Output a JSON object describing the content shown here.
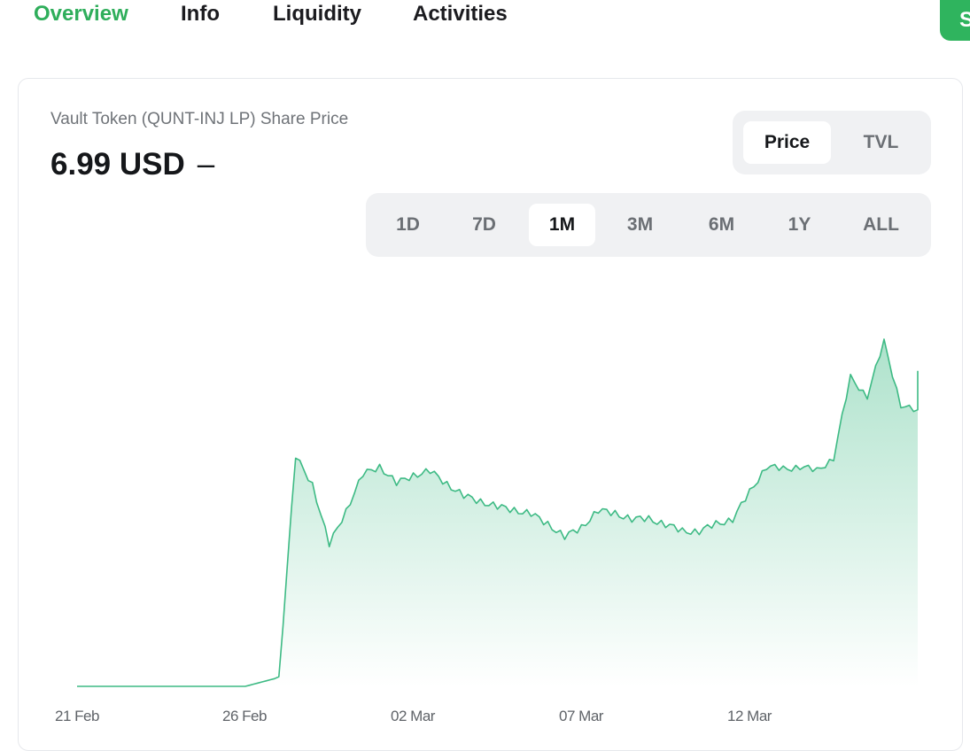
{
  "tabs": [
    {
      "label": "Overview",
      "active": true
    },
    {
      "label": "Info",
      "active": false
    },
    {
      "label": "Liquidity",
      "active": false
    },
    {
      "label": "Activities",
      "active": false
    }
  ],
  "top_right_button": {
    "label": "S",
    "color": "#2fb45e"
  },
  "card": {
    "title": "Vault Token (QUNT-INJ LP) Share Price",
    "price": "6.99 USD",
    "change": "–"
  },
  "metric_toggle": {
    "options": [
      "Price",
      "TVL"
    ],
    "selected": "Price"
  },
  "range_selector": {
    "options": [
      "1D",
      "7D",
      "1M",
      "3M",
      "6M",
      "1Y",
      "ALL"
    ],
    "selected": "1M"
  },
  "colors": {
    "accent": "#2fae5b",
    "line": "#3dba84"
  },
  "chart_data": {
    "type": "area",
    "title": "",
    "xlabel": "",
    "ylabel": "",
    "x_tick_labels": [
      "21 Feb",
      "26 Feb",
      "02 Mar",
      "07 Mar",
      "12 Mar"
    ],
    "grid": false,
    "legend": false,
    "series": [
      {
        "x": [
          "2024-02-21",
          "2024-02-22",
          "2024-02-23",
          "2024-02-24",
          "2024-02-25",
          "2024-02-26",
          "2024-02-27",
          "2024-02-27",
          "2024-02-28",
          "2024-02-28",
          "2024-02-29",
          "2024-02-29",
          "2024-03-01",
          "2024-03-01",
          "2024-03-02",
          "2024-03-02",
          "2024-03-03",
          "2024-03-03",
          "2024-03-04",
          "2024-03-04",
          "2024-03-05",
          "2024-03-05",
          "2024-03-06",
          "2024-03-06",
          "2024-03-07",
          "2024-03-07",
          "2024-03-08",
          "2024-03-08",
          "2024-03-09",
          "2024-03-09",
          "2024-03-10",
          "2024-03-10",
          "2024-03-11",
          "2024-03-11",
          "2024-03-12",
          "2024-03-12",
          "2024-03-13",
          "2024-03-13",
          "2024-03-14",
          "2024-03-14",
          "2024-03-15",
          "2024-03-15",
          "2024-03-16",
          "2024-03-16",
          "2024-03-17",
          "2024-03-17"
        ],
        "y": [
          5.2,
          5.2,
          5.2,
          5.2,
          5.2,
          5.2,
          5.25,
          6.5,
          6.35,
          6.0,
          6.2,
          6.4,
          6.45,
          6.35,
          6.4,
          6.42,
          6.35,
          6.28,
          6.25,
          6.22,
          6.2,
          6.18,
          6.12,
          6.05,
          6.1,
          6.2,
          6.18,
          6.15,
          6.15,
          6.12,
          6.08,
          6.08,
          6.12,
          6.15,
          6.3,
          6.45,
          6.43,
          6.45,
          6.42,
          6.5,
          6.95,
          6.85,
          7.15,
          6.8,
          6.75,
          6.99
        ]
      }
    ]
  }
}
